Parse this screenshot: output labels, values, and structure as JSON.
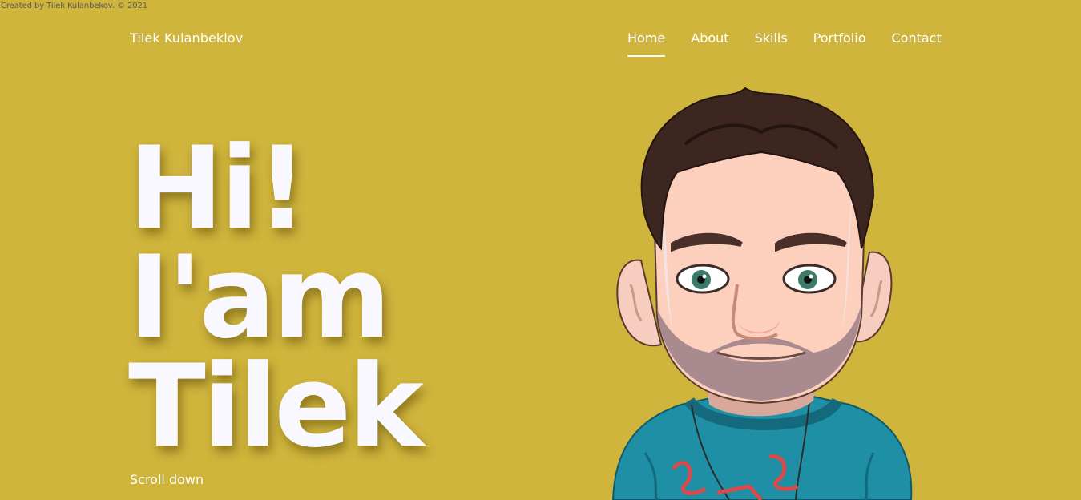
{
  "credit": "Created by Tilek Kulanbekov. © 2021",
  "brand": "Tilek Kulanbeklov",
  "nav": [
    {
      "label": "Home",
      "active": true
    },
    {
      "label": "About"
    },
    {
      "label": "Skills"
    },
    {
      "label": "Portfolio"
    },
    {
      "label": "Contact"
    }
  ],
  "hero": {
    "line1": "Hi!",
    "line2": "I'am",
    "line3": "Tilek"
  },
  "scroll_label": "Scroll down",
  "colors": {
    "background": "#CFB53B",
    "text": "#FFFFFF",
    "hero_text": "#FAF8FF",
    "shirt": "#1F8FA6"
  }
}
